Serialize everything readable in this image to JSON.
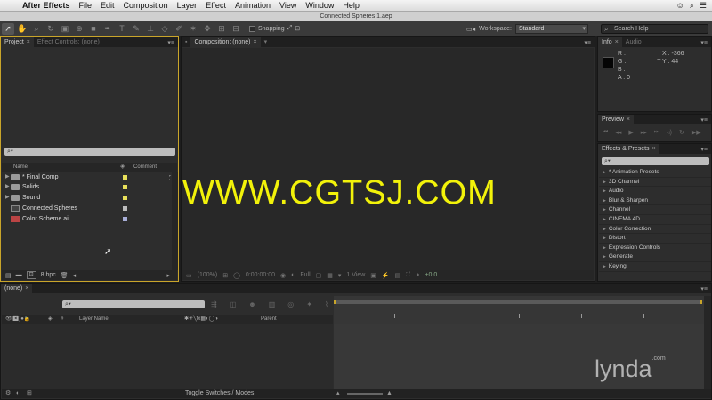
{
  "menubar": {
    "app_name": "After Effects",
    "items": [
      "File",
      "Edit",
      "Composition",
      "Layer",
      "Effect",
      "Animation",
      "View",
      "Window",
      "Help"
    ]
  },
  "window": {
    "title": "Connected Spheres 1.aep"
  },
  "toolbar": {
    "snapping_label": "Snapping",
    "workspace_label": "Workspace:",
    "workspace_value": "Standard",
    "search_help_placeholder": "Search Help"
  },
  "project": {
    "tabs": {
      "project": "Project",
      "effect_controls": "Effect Controls: (none)"
    },
    "search_placeholder": "",
    "columns": {
      "name": "Name",
      "comment": "Comment"
    },
    "items": [
      {
        "name": "* Final Comp",
        "type": "folder",
        "color": "#e8e05a"
      },
      {
        "name": "Solids",
        "type": "folder",
        "color": "#e8e05a"
      },
      {
        "name": "Sound",
        "type": "folder",
        "color": "#e8e05a"
      },
      {
        "name": "Connected Spheres",
        "type": "comp",
        "color": "#bcbcbc"
      },
      {
        "name": "Color Scheme.ai",
        "type": "image",
        "color": "#a8aed8"
      }
    ],
    "bpc_label": "8 bpc"
  },
  "composition": {
    "tab": "Composition: (none)",
    "footer": {
      "zoom": "(100%)",
      "timecode": "0:00:00:00",
      "resolution": "Full",
      "view": "1 View",
      "exposure": "+0.0"
    }
  },
  "info": {
    "tabs": {
      "info": "Info",
      "audio": "Audio"
    },
    "r": "R :",
    "g": "G :",
    "b": "B :",
    "a": "A : 0",
    "x": "X : -366",
    "y": "Y : 44"
  },
  "preview": {
    "tab": "Preview"
  },
  "effects": {
    "tab": "Effects & Presets",
    "items": [
      "* Animation Presets",
      "3D Channel",
      "Audio",
      "Blur & Sharpen",
      "Channel",
      "CINEMA 4D",
      "Color Correction",
      "Distort",
      "Expression Controls",
      "Generate",
      "Keying"
    ]
  },
  "timeline": {
    "tab": "(none)",
    "columns": {
      "layer_name": "Layer Name",
      "parent": "Parent",
      "num": "#"
    },
    "toggle_label": "Toggle Switches / Modes"
  },
  "watermark": "WWW.CGTSJ.COM",
  "brand": "lynda",
  "brand_suffix": ".com"
}
